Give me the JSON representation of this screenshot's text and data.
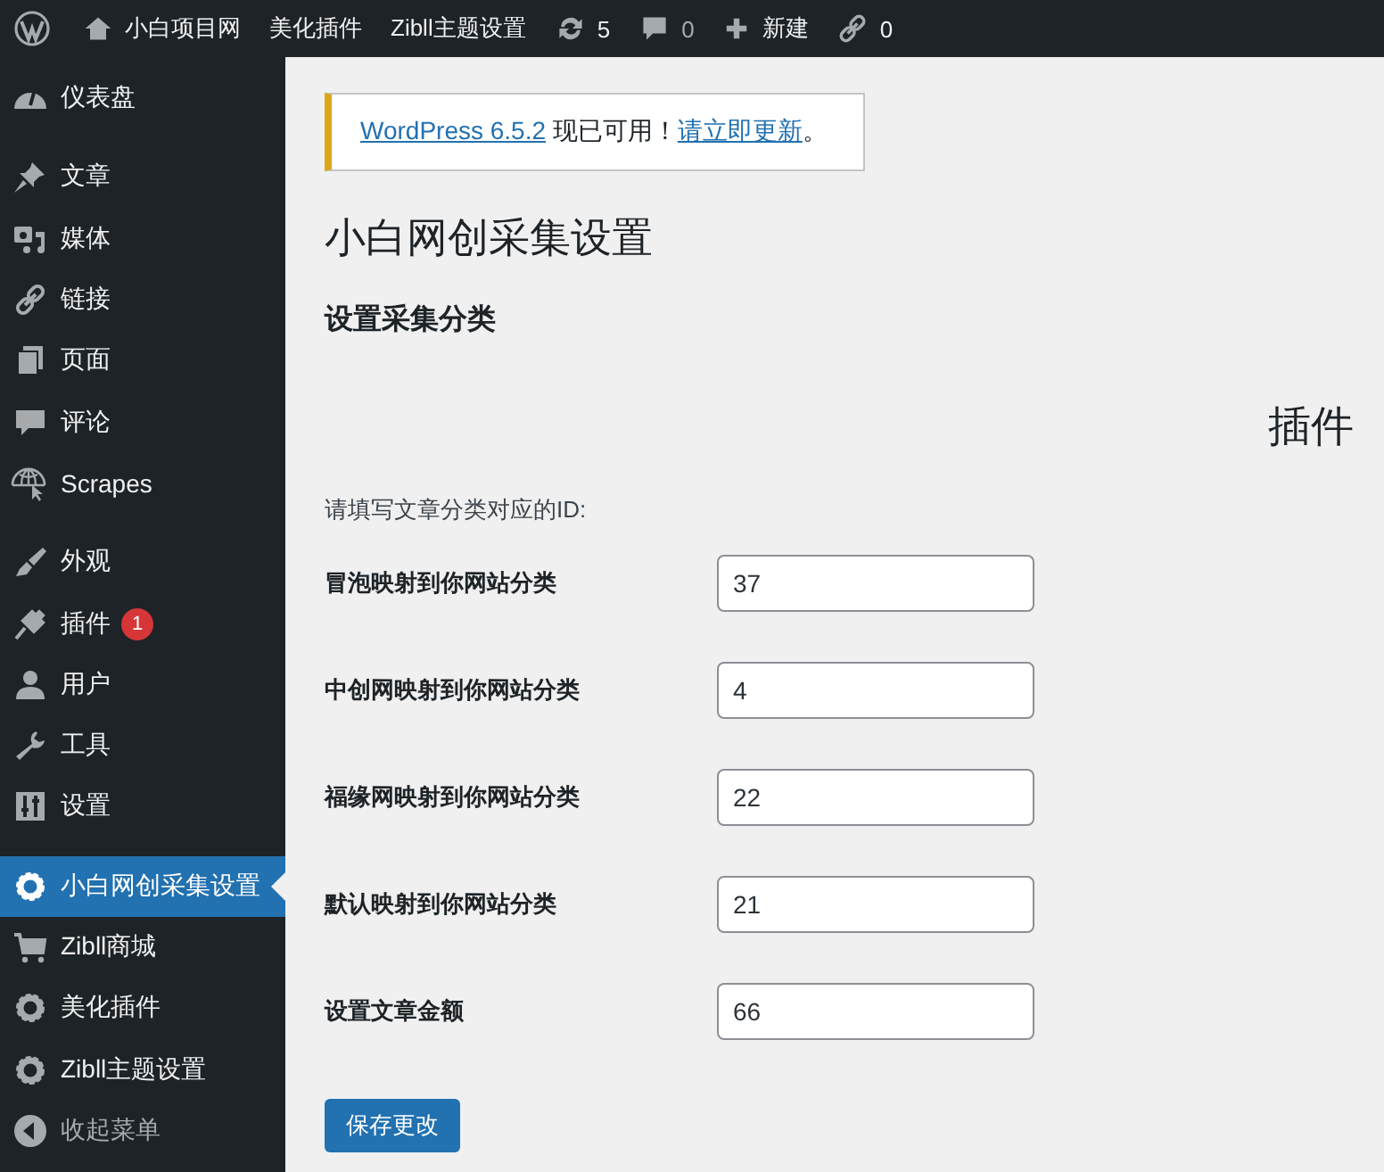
{
  "admin_bar": {
    "items": [
      {
        "kind": "logo"
      },
      {
        "kind": "home",
        "label": "小白项目网"
      },
      {
        "kind": "text",
        "label": "美化插件"
      },
      {
        "kind": "text",
        "label": "Zibll主题设置"
      },
      {
        "kind": "updates",
        "label": "5"
      },
      {
        "kind": "comments",
        "label": "0"
      },
      {
        "kind": "new",
        "label": "新建"
      },
      {
        "kind": "links",
        "label": "0"
      }
    ]
  },
  "sidebar": {
    "groups": [
      [
        {
          "label": "仪表盘",
          "selected": false
        }
      ],
      [
        {
          "label": "文章",
          "selected": false
        },
        {
          "label": "媒体",
          "selected": false
        },
        {
          "label": "链接",
          "selected": false
        },
        {
          "label": "页面",
          "selected": false
        },
        {
          "label": "评论",
          "selected": false
        },
        {
          "label": "Scrapes",
          "selected": false
        }
      ],
      [
        {
          "label": "外观",
          "selected": false
        },
        {
          "label": "插件",
          "selected": false,
          "badge": "1"
        },
        {
          "label": "用户",
          "selected": false
        },
        {
          "label": "工具",
          "selected": false
        },
        {
          "label": "设置",
          "selected": false
        }
      ],
      [
        {
          "label": "小白网创采集设置",
          "selected": true
        },
        {
          "label": "Zibll商城",
          "selected": false
        },
        {
          "label": "美化插件",
          "selected": false
        },
        {
          "label": "Zibll主题设置",
          "selected": false
        },
        {
          "label": "收起菜单",
          "selected": false,
          "kind": "collapse"
        }
      ]
    ]
  },
  "notice": {
    "parts": [
      {
        "kind": "link",
        "text": "WordPress 6.5.2"
      },
      {
        "kind": "text",
        "text": " 现已可用！"
      },
      {
        "kind": "link",
        "text": "请立即更新"
      },
      {
        "kind": "text",
        "text": "。"
      }
    ]
  },
  "page_title": "小白网创采集设置",
  "section_title": "设置采集分类",
  "side_heading": "插件",
  "description": "请填写文章分类对应的ID:",
  "fields": [
    {
      "label": "冒泡映射到你网站分类",
      "value": "37"
    },
    {
      "label": "中创网映射到你网站分类",
      "value": "4"
    },
    {
      "label": "福缘网映射到你网站分类",
      "value": "22"
    },
    {
      "label": "默认映射到你网站分类",
      "value": "21"
    },
    {
      "label": "设置文章金额",
      "value": "66"
    }
  ],
  "save_button": "保存更改"
}
